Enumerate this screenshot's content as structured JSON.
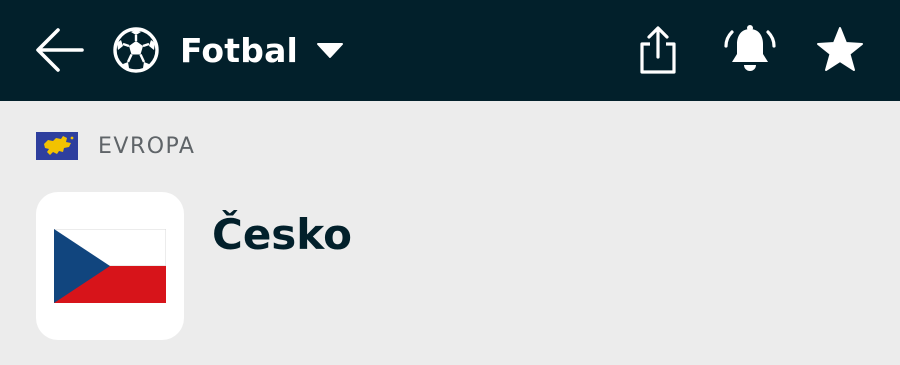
{
  "header": {
    "back_icon": "arrow-left-icon",
    "sport": {
      "icon": "soccer-ball-icon",
      "label": "Fotbal",
      "dropdown_icon": "caret-down-icon"
    },
    "actions": [
      {
        "icon": "share-icon"
      },
      {
        "icon": "bell-ringing-icon"
      },
      {
        "icon": "star-icon"
      }
    ],
    "colors": {
      "background": "#02202b",
      "foreground": "#ffffff"
    }
  },
  "region": {
    "flag_icon": "europe-flag-icon",
    "label": "EVROPA"
  },
  "team": {
    "logo_icon": "czech-flag-icon",
    "name": "Česko",
    "flag_colors": {
      "white": "#ffffff",
      "red": "#d7141a",
      "blue": "#11457e"
    }
  },
  "page": {
    "background": "#ececec"
  }
}
